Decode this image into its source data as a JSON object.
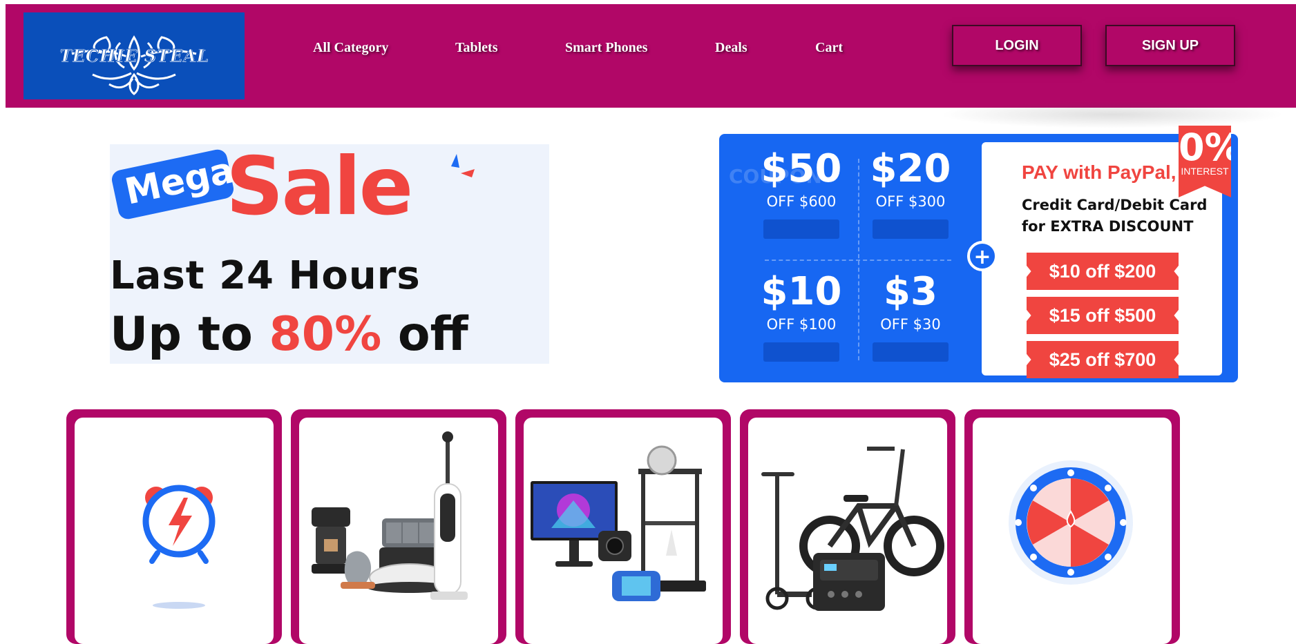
{
  "header": {
    "brand_text": "TECHIE STEAL",
    "nav": [
      {
        "label": "All Category"
      },
      {
        "label": "Tablets"
      },
      {
        "label": "Smart Phones"
      },
      {
        "label": "Deals"
      },
      {
        "label": "Cart"
      }
    ],
    "login_label": "LOGIN",
    "signup_label": "SIGN UP"
  },
  "mega_banner": {
    "badge": "Mega",
    "headline": "Sale",
    "line1": "Last 24 Hours",
    "line2_prefix": "Up to ",
    "line2_highlight": "80%",
    "line2_suffix": " off"
  },
  "coupon_banner": {
    "side_label": "COUPON",
    "coupons": [
      {
        "amount": "$50",
        "condition": "OFF $600"
      },
      {
        "amount": "$20",
        "condition": "OFF $300"
      },
      {
        "amount": "$10",
        "condition": "OFF $100"
      },
      {
        "amount": "$3",
        "condition": "OFF $30"
      }
    ],
    "plus_symbol": "+",
    "paypal_title": "PAY with PayPal,",
    "paypal_sub1": "Credit Card/Debit Card",
    "paypal_sub2": "for EXTRA DISCOUNT",
    "paypal_offers": [
      "$10 off $200",
      "$15 off $500",
      "$25 off $700"
    ],
    "ribbon_value": "0%",
    "ribbon_label": "INTEREST"
  },
  "category_cards": [
    {
      "icon": "flash-deal-alarm-icon"
    },
    {
      "icon": "home-appliances-icon"
    },
    {
      "icon": "electronics-icon"
    },
    {
      "icon": "e-mobility-icon"
    },
    {
      "icon": "lucky-wheel-icon"
    }
  ],
  "colors": {
    "brand_magenta": "#b10767",
    "logo_blue": "#0a4fba",
    "coupon_blue": "#1767f2",
    "sale_red": "#f04540"
  }
}
